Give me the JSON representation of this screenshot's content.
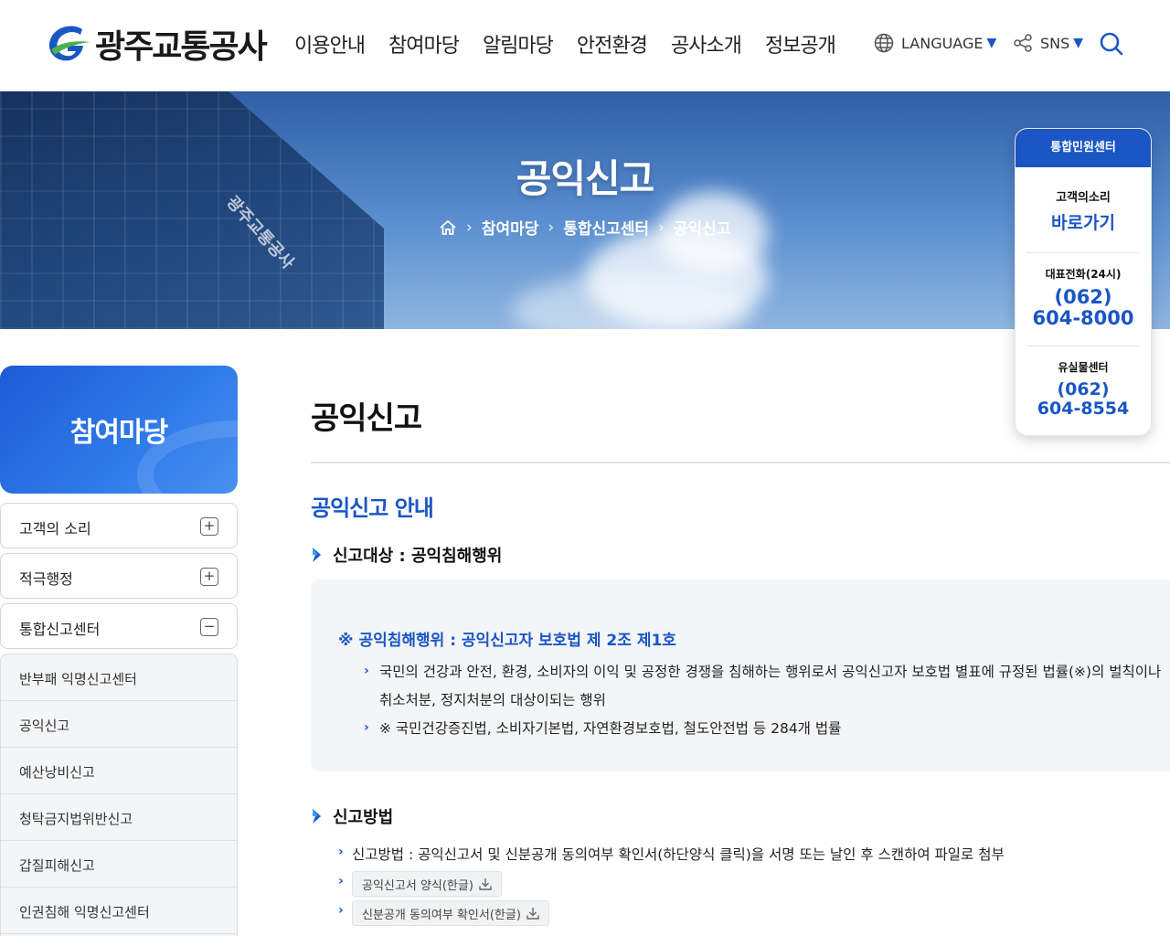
{
  "header": {
    "logo_text": "광주교통공사",
    "nav": [
      "이용안내",
      "참여마당",
      "알림마당",
      "안전환경",
      "공사소개",
      "정보공개"
    ],
    "language_label": "LANGUAGE",
    "sns_label": "SNS"
  },
  "visual": {
    "title": "공익신고",
    "building_sign": "광주교통공사",
    "breadcrumb": [
      "참여마당",
      "통합신고센터",
      "공익신고"
    ]
  },
  "quick": {
    "head": "통합민원센터",
    "voice_label": "고객의소리",
    "voice_link": "바로가기",
    "rep_label": "대표전화(24시)",
    "rep_area": "(062)",
    "rep_number": "604-8000",
    "lost_label": "유실물센터",
    "lost_area": "(062)",
    "lost_number": "604-8554"
  },
  "side": {
    "title": "참여마당",
    "menus": [
      {
        "label": "고객의 소리",
        "sign": "+"
      },
      {
        "label": "적극행정",
        "sign": "+"
      },
      {
        "label": "통합신고센터",
        "sign": "−"
      }
    ],
    "subs": [
      "반부패 익명신고센터",
      "공익신고",
      "예산낭비신고",
      "청탁금지법위반신고",
      "갑질피해신고",
      "인권침해 익명신고센터"
    ]
  },
  "content": {
    "page_title": "공익신고",
    "section_title": "공익신고 안내",
    "target_heading": "신고대상 : 공익침해행위",
    "box_title": "※ 공익침해행위 : 공익신고자 보호법 제 2조 제1호",
    "box_item1_line1": "국민의 건강과 안전, 환경, 소비자의 이익 및 공정한 경쟁을 침해하는 행위로서 공익신고자 보호법 별표에 규정된 법률(※)의 벌칙이나",
    "box_item1_line2": "취소처분, 정지처분의 대상이되는 행위",
    "box_item2": "※ 국민건강증진법, 소비자기본법, 자연환경보호법, 철도안전법 등 284개 법률",
    "method_heading": "신고방법",
    "method_text": "신고방법 : 공익신고서 및 신분공개 동의여부 확인서(하단양식 클릭)을 서명 또는 날인 후 스캔하여 파일로 첨부",
    "download1": "공익신고서 양식(한글)",
    "download2": "신분공개 동의여부 확인서(한글)"
  },
  "colors": {
    "brand_blue": "#1a56c4",
    "logo_green": "#4caf50"
  }
}
